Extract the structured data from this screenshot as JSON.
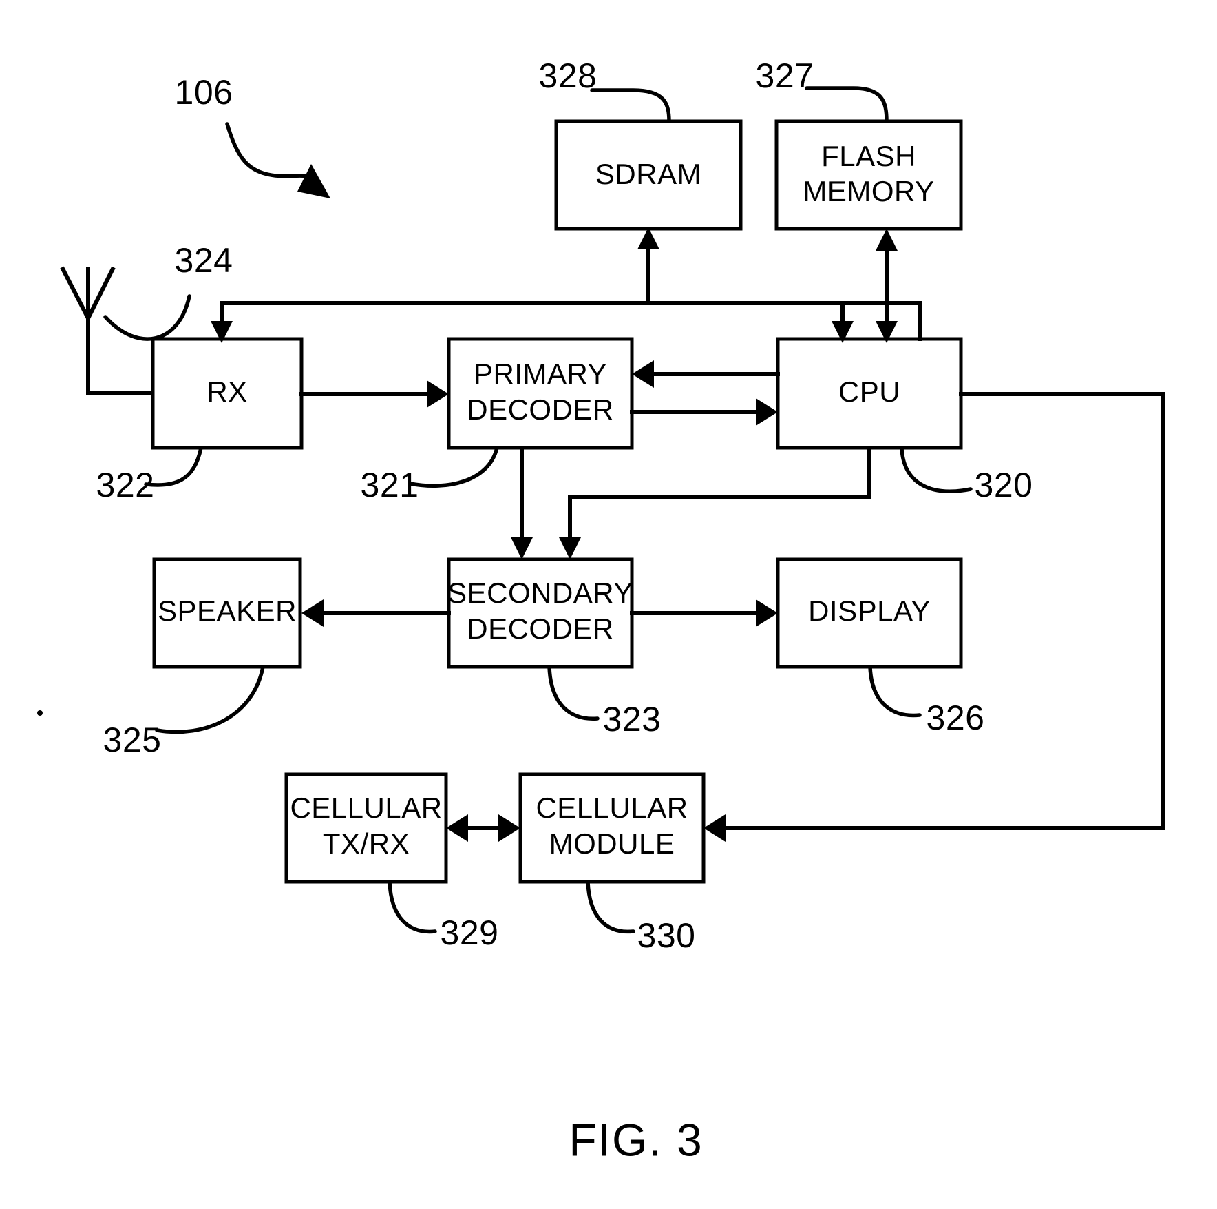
{
  "figure": {
    "caption": "FIG. 3",
    "assembly_ref": "106"
  },
  "blocks": [
    {
      "id": "sdram",
      "lines": [
        "SDRAM"
      ],
      "ref": "328"
    },
    {
      "id": "flash_memory",
      "lines": [
        "FLASH",
        "MEMORY"
      ],
      "ref": "327"
    },
    {
      "id": "rx",
      "lines": [
        "RX"
      ],
      "ref": "322"
    },
    {
      "id": "primary_decoder",
      "lines": [
        "PRIMARY",
        "DECODER"
      ],
      "ref": "321"
    },
    {
      "id": "cpu",
      "lines": [
        "CPU"
      ],
      "ref": "320"
    },
    {
      "id": "speaker",
      "lines": [
        "SPEAKER"
      ],
      "ref": "325"
    },
    {
      "id": "secondary_decoder",
      "lines": [
        "SECONDARY",
        "DECODER"
      ],
      "ref": "323"
    },
    {
      "id": "display",
      "lines": [
        "DISPLAY"
      ],
      "ref": "326"
    },
    {
      "id": "cellular_txrx",
      "lines": [
        "CELLULAR",
        "TX/RX"
      ],
      "ref": "329"
    },
    {
      "id": "cellular_module",
      "lines": [
        "CELLULAR",
        "MODULE"
      ],
      "ref": "330"
    }
  ],
  "antenna": {
    "ref": "324"
  },
  "labels": {
    "sdram": "SDRAM",
    "flash_line1": "FLASH",
    "flash_line2": "MEMORY",
    "rx": "RX",
    "primary_line1": "PRIMARY",
    "primary_line2": "DECODER",
    "cpu": "CPU",
    "speaker": "SPEAKER",
    "secondary_line1": "SECONDARY",
    "secondary_line2": "DECODER",
    "display": "DISPLAY",
    "cell_txrx_line1": "CELLULAR",
    "cell_txrx_line2": "TX/RX",
    "cell_mod_line1": "CELLULAR",
    "cell_mod_line2": "MODULE"
  },
  "refs": {
    "r106": "106",
    "r320": "320",
    "r321": "321",
    "r322": "322",
    "r323": "323",
    "r324": "324",
    "r325": "325",
    "r326": "326",
    "r327": "327",
    "r328": "328",
    "r329": "329",
    "r330": "330"
  },
  "colors": {
    "line": "#000000",
    "fill": "#ffffff"
  }
}
